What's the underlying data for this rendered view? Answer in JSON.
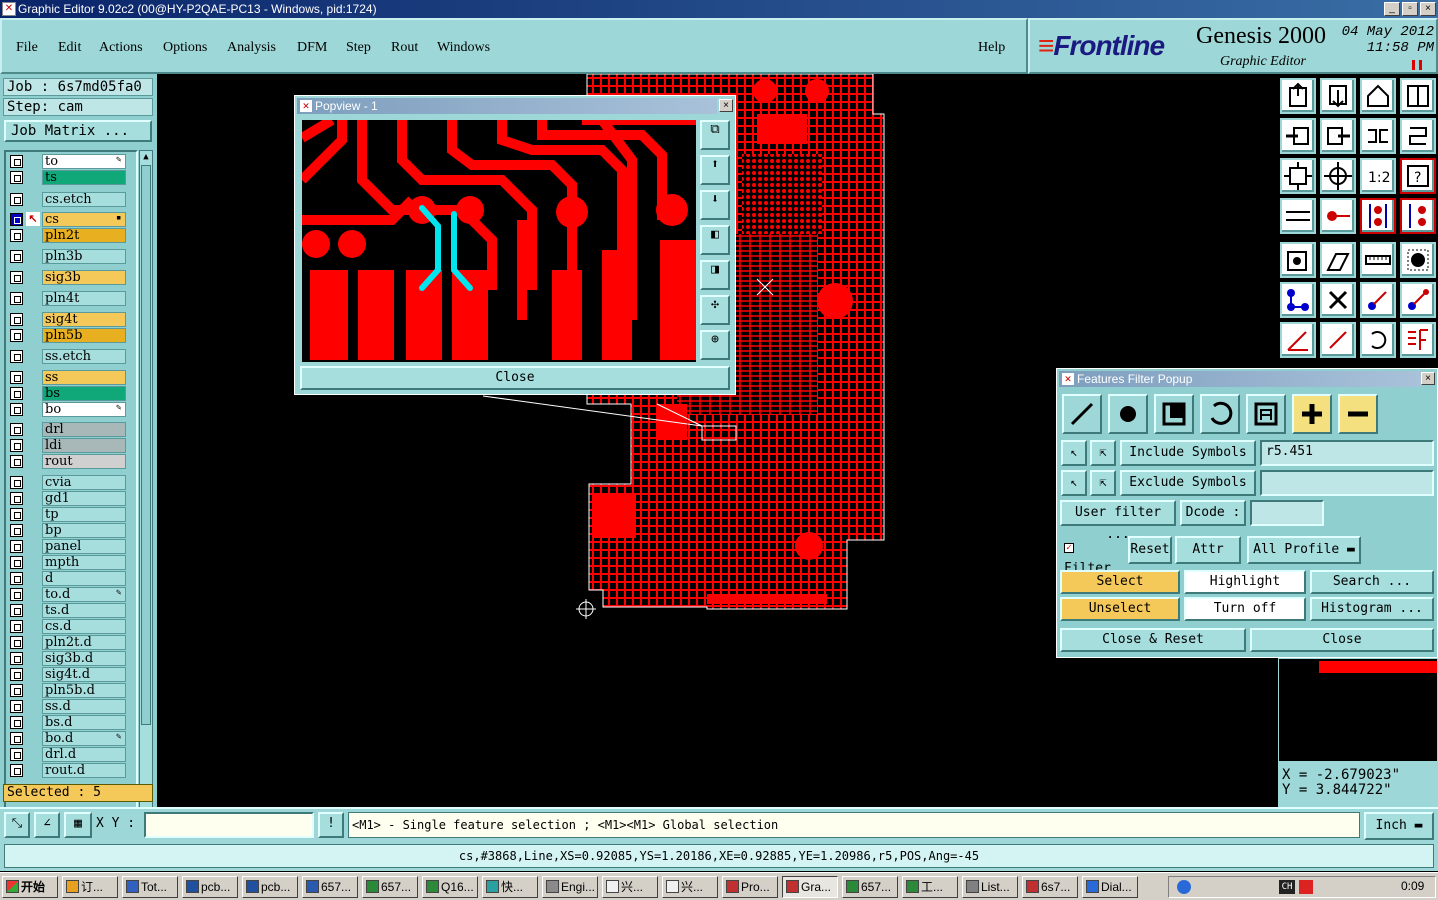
{
  "window": {
    "title": "Graphic Editor 9.02c2 (00@HY-P2QAE-PC13 - Windows, pid:1724)",
    "min": "_",
    "max": "▫",
    "close": "×"
  },
  "menu": {
    "items": [
      "File",
      "Edit",
      "Actions",
      "Options",
      "Analysis",
      "DFM",
      "Step",
      "Rout",
      "Windows"
    ],
    "help": "Help"
  },
  "brand": {
    "logo": "Frontline",
    "product": "Genesis 2000",
    "subtitle": "Graphic Editor",
    "date": "04 May 2012",
    "time": "11:58 PM"
  },
  "job": {
    "job_label": "Job : 6s7md05fa0",
    "step_label": "Step: cam",
    "matrix_button": "Job Matrix ..."
  },
  "layers": [
    {
      "name": "to",
      "color": "#ffffff",
      "mark": "✎"
    },
    {
      "name": "ts",
      "color": "#10a878"
    },
    {
      "name": "cs.etch",
      "color": "#a6dede"
    },
    {
      "name": "cs",
      "color": "#f5c85a",
      "selected": true,
      "mark": "▪"
    },
    {
      "name": "pln2t",
      "color": "#e8b020"
    },
    {
      "name": "pln3b",
      "color": "#a6dede"
    },
    {
      "name": "sig3b",
      "color": "#f5c85a"
    },
    {
      "name": "pln4t",
      "color": "#a6dede"
    },
    {
      "name": "sig4t",
      "color": "#f5c85a"
    },
    {
      "name": "pln5b",
      "color": "#e8b020"
    },
    {
      "name": "ss.etch",
      "color": "#a6dede"
    },
    {
      "name": "ss",
      "color": "#f5c85a"
    },
    {
      "name": "bs",
      "color": "#10a878"
    },
    {
      "name": "bo",
      "color": "#ffffff",
      "mark": "✎"
    },
    {
      "name": "drl",
      "color": "#a8b8b8"
    },
    {
      "name": "ldi",
      "color": "#a8b8b8"
    },
    {
      "name": "rout",
      "color": "#d0d0d0"
    },
    {
      "name": "cvia",
      "color": "#a6dede"
    },
    {
      "name": "gd1",
      "color": "#a6dede"
    },
    {
      "name": "tp",
      "color": "#a6dede"
    },
    {
      "name": "bp",
      "color": "#a6dede"
    },
    {
      "name": "panel",
      "color": "#a6dede"
    },
    {
      "name": "mpth",
      "color": "#a6dede"
    },
    {
      "name": "d",
      "color": "#a6dede"
    },
    {
      "name": "to.d",
      "color": "#a6dede",
      "mark": "✎"
    },
    {
      "name": "ts.d",
      "color": "#a6dede"
    },
    {
      "name": "cs.d",
      "color": "#a6dede"
    },
    {
      "name": "pln2t.d",
      "color": "#a6dede"
    },
    {
      "name": "sig3b.d",
      "color": "#a6dede"
    },
    {
      "name": "sig4t.d",
      "color": "#a6dede"
    },
    {
      "name": "pln5b.d",
      "color": "#a6dede"
    },
    {
      "name": "ss.d",
      "color": "#a6dede"
    },
    {
      "name": "bs.d",
      "color": "#a6dede"
    },
    {
      "name": "bo.d",
      "color": "#a6dede",
      "mark": "✎"
    },
    {
      "name": "drl.d",
      "color": "#a6dede"
    },
    {
      "name": "rout.d",
      "color": "#a6dede"
    }
  ],
  "selected_count": "Selected : 5",
  "popview": {
    "title": "Popview - 1",
    "close": "Close"
  },
  "filter": {
    "title": "Features Filter Popup",
    "include_label": "Include Symbols :",
    "include_value": "r5.451",
    "exclude_label": "Exclude Symbols :",
    "exclude_value": "",
    "user_filter": "User filter ...",
    "dcode": "Dcode :",
    "dcode_value": "",
    "filter": "Filter",
    "reset": "Reset",
    "attr": "Attr ...",
    "profile": "All Profile",
    "select": "Select",
    "highlight": "Highlight",
    "search": "Search ...",
    "unselect": "Unselect",
    "turn_off": "Turn off",
    "histogram": "Histogram ...",
    "close_reset": "Close & Reset",
    "close": "Close"
  },
  "coords": {
    "x": "X = -2.679023\"",
    "y": "Y = 3.844722\""
  },
  "bottom": {
    "xy_label": "X Y :",
    "xy_value": "",
    "hint": "<M1> - Single feature selection ; <M1><M1> Global selection",
    "units": "Inch"
  },
  "status_line": "cs,#3868,Line,XS=0.92085,YS=1.20186,XE=0.92885,YE=1.20986,r5,POS,Ang=-45",
  "taskbar": {
    "start": "开始",
    "items": [
      "订...",
      "Tot...",
      "pcb...",
      "pcb...",
      "657...",
      "657...",
      "Q16...",
      "快...",
      "Engi...",
      "兴...",
      "兴...",
      "Pro...",
      "Gra...",
      "657...",
      "工...",
      "List...",
      "6s7...",
      "Dial..."
    ],
    "clock": "0:09"
  },
  "colors": {
    "copper": "#ff0000",
    "panel": "#9ed7d7",
    "highlight": "#00e5ee"
  }
}
